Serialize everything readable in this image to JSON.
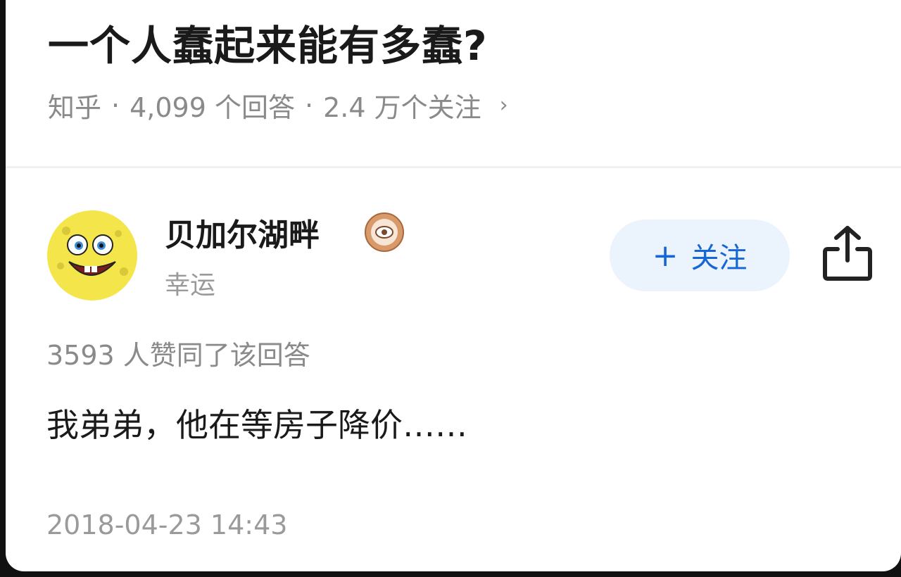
{
  "question": {
    "title": "一个人蠢起来能有多蠢?",
    "source": "知乎",
    "separator": "·",
    "answers": "4,099 个回答",
    "followers": "2.4 万个关注",
    "chevron": "›"
  },
  "author": {
    "name": "贝加尔湖畔",
    "tag": "幸运",
    "avatar_icon": "spongebob-avatar",
    "badge_icon": "donut-badge-icon"
  },
  "follow_button": {
    "plus": "+",
    "label": "关注"
  },
  "share_icon": "share-icon",
  "answer": {
    "votes": "3593 人赞同了该回答",
    "content": "我弟弟，他在等房子降价……",
    "timestamp": "2018-04-23 14:43"
  },
  "colors": {
    "accent": "#1766d6",
    "follow_bg": "#ebf3fc",
    "text_primary": "#1a1a1a",
    "text_secondary": "#8a8a8a",
    "avatar_yellow": "#f4e54a"
  }
}
